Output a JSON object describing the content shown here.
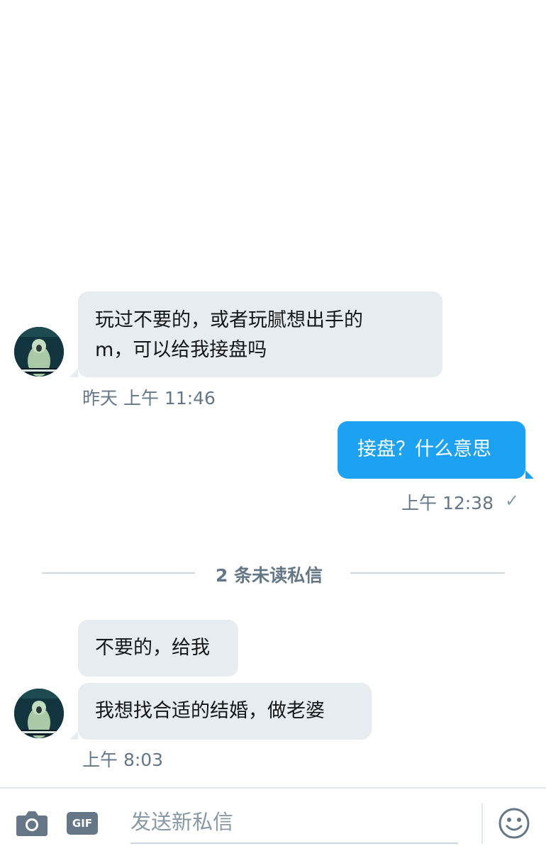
{
  "messages": [
    {
      "direction": "in",
      "text_line1": "玩过不要的，或者玩腻想出手的",
      "text_line2": "m，可以给我接盘吗"
    },
    {
      "direction": "out",
      "text": "接盘？什么意思"
    }
  ],
  "timestamps": {
    "first": "昨天 上午 11:46",
    "second": "上午 12:38",
    "third": "上午 8:03"
  },
  "read_receipt": "✓",
  "unread_divider": "2 条未读私信",
  "unread_messages": [
    {
      "text": "不要的，给我"
    },
    {
      "text": "我想找合适的结婚，做老婆"
    }
  ],
  "composer": {
    "placeholder": "发送新私信",
    "gif_label": "GIF",
    "icons": [
      "camera-icon",
      "gif-icon",
      "emoji-icon"
    ]
  },
  "colors": {
    "incoming_bubble": "#e6ecf0",
    "outgoing_bubble": "#1da1f2",
    "meta_text": "#657786"
  }
}
